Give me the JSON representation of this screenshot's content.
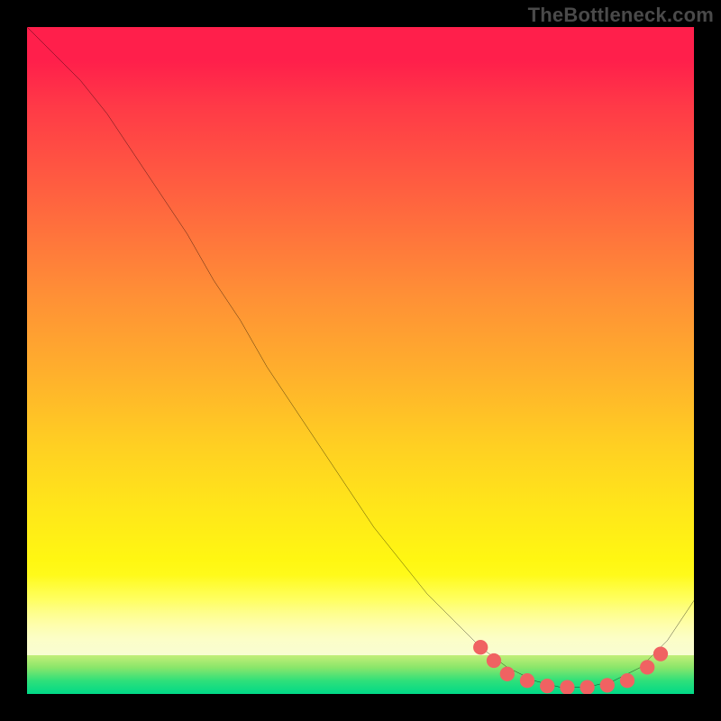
{
  "watermark": "TheBottleneck.com",
  "chart_data": {
    "type": "line",
    "title": "",
    "xlabel": "",
    "ylabel": "",
    "xlim": [
      0,
      100
    ],
    "ylim": [
      0,
      100
    ],
    "grid": false,
    "legend": false,
    "series": [
      {
        "name": "bottleneck-curve",
        "x": [
          0,
          4,
          8,
          12,
          16,
          20,
          24,
          28,
          32,
          36,
          40,
          44,
          48,
          52,
          56,
          60,
          64,
          68,
          72,
          76,
          80,
          84,
          88,
          92,
          96,
          100
        ],
        "y": [
          100,
          96,
          92,
          87,
          81,
          75,
          69,
          62,
          56,
          49,
          43,
          37,
          31,
          25,
          20,
          15,
          11,
          7,
          4,
          2,
          1,
          1,
          2,
          4,
          8,
          14
        ]
      }
    ],
    "markers": {
      "name": "highlight-dots",
      "color": "#f06262",
      "points": [
        {
          "x": 68,
          "y": 7
        },
        {
          "x": 70,
          "y": 5
        },
        {
          "x": 72,
          "y": 3
        },
        {
          "x": 75,
          "y": 2
        },
        {
          "x": 78,
          "y": 1.2
        },
        {
          "x": 81,
          "y": 1
        },
        {
          "x": 84,
          "y": 1
        },
        {
          "x": 87,
          "y": 1.3
        },
        {
          "x": 90,
          "y": 2
        },
        {
          "x": 93,
          "y": 4
        },
        {
          "x": 95,
          "y": 6
        }
      ]
    },
    "background_gradient": {
      "top": "#ff1f4b",
      "mid": "#ffe61a",
      "bottom": "#00d987"
    }
  }
}
